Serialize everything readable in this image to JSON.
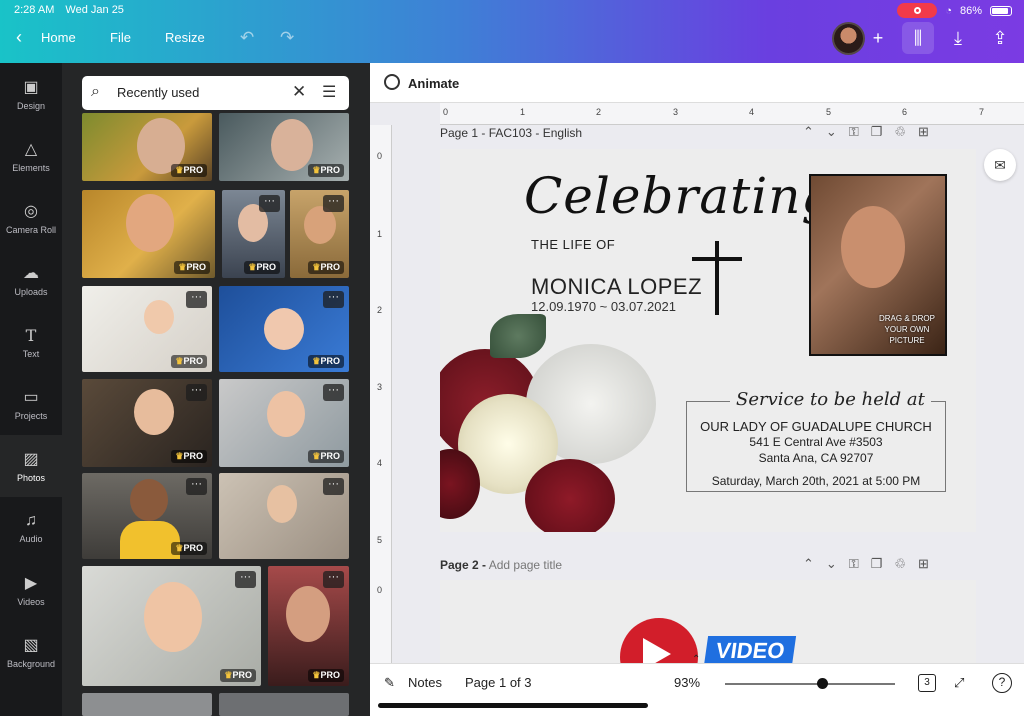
{
  "status": {
    "time": "2:28 AM",
    "date": "Wed Jan 25",
    "battery": "86%"
  },
  "nav": {
    "home": "Home",
    "file": "File",
    "resize": "Resize",
    "back_icon": "chevron-left-icon"
  },
  "sidebar": {
    "items": [
      {
        "label": "Design",
        "icon": "layout-icon"
      },
      {
        "label": "Elements",
        "icon": "shapes-icon"
      },
      {
        "label": "Camera Roll",
        "icon": "camera-icon"
      },
      {
        "label": "Uploads",
        "icon": "cloud-upload-icon"
      },
      {
        "label": "Text",
        "icon": "text-icon"
      },
      {
        "label": "Projects",
        "icon": "folder-icon"
      },
      {
        "label": "Photos",
        "icon": "image-icon"
      },
      {
        "label": "Audio",
        "icon": "music-icon"
      },
      {
        "label": "Videos",
        "icon": "video-icon"
      },
      {
        "label": "Background",
        "icon": "pattern-icon"
      }
    ]
  },
  "search": {
    "value": "Recently used"
  },
  "photos": {
    "pro_label": "PRO",
    "more_label": "···"
  },
  "editor": {
    "animate_label": "Animate",
    "page1": {
      "label": "Page 1 - FAC103 - English"
    },
    "page2": {
      "label": "Page 2 -",
      "placeholder": "Add page title"
    }
  },
  "card": {
    "headline": "Celebrating",
    "life_of": "THE LIFE OF",
    "name": "MONICA LOPEZ",
    "dates": "12.09.1970 ~ 03.07.2021",
    "drag_drop": "DRAG & DROP YOUR OWN PICTURE",
    "service_title": "Service to be held at",
    "church": "OUR LADY OF GUADALUPE CHURCH",
    "address1": "541 E Central Ave #3503",
    "address2": "Santa Ana, CA 92707",
    "datetime": "Saturday, March 20th, 2021 at 5:00 PM"
  },
  "page2_preview": {
    "text": "VIDEO"
  },
  "ruler": {
    "marks_h": [
      "0",
      "1",
      "2",
      "3",
      "4",
      "5",
      "6",
      "7"
    ],
    "marks_v": [
      "0",
      "1",
      "2",
      "3",
      "4",
      "5",
      "0"
    ]
  },
  "bottom": {
    "notes": "Notes",
    "page_indicator": "Page 1 of 3",
    "zoom": "93%",
    "page_count": "3",
    "help": "?"
  }
}
